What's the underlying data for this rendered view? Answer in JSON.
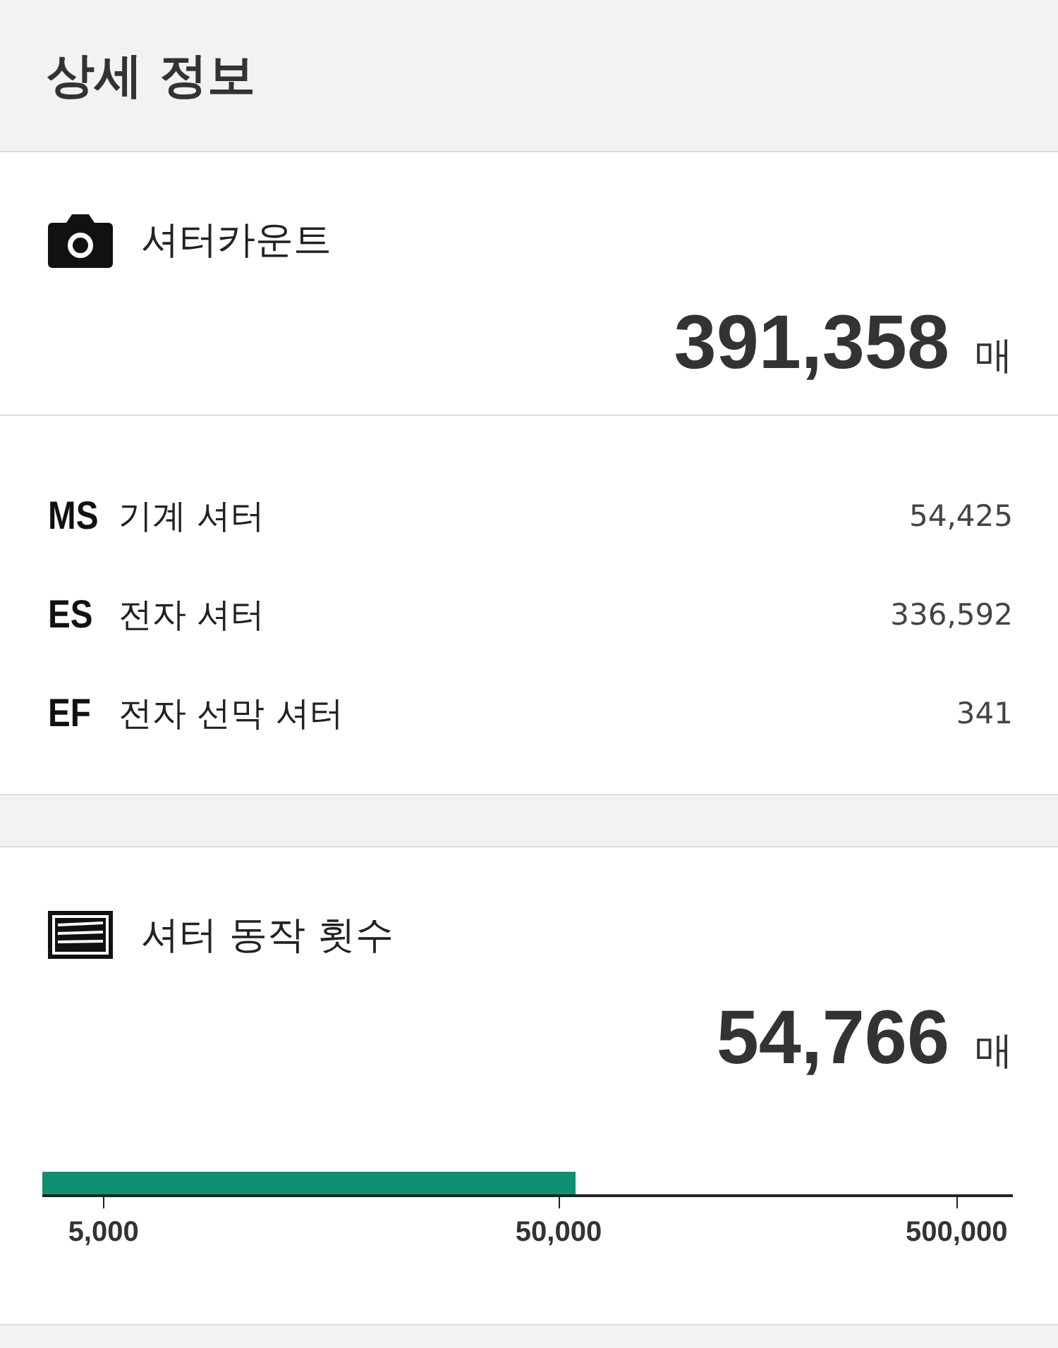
{
  "header": {
    "title": "상세 정보"
  },
  "shutter_count": {
    "label": "셔터카운트",
    "value": "391,358",
    "unit": "매"
  },
  "breakdown": [
    {
      "code": "MS",
      "label": "기계 셔터",
      "value": "54,425"
    },
    {
      "code": "ES",
      "label": "전자 셔터",
      "value": "336,592"
    },
    {
      "code": "EF",
      "label": "전자 선막 셔터",
      "value": "341"
    }
  ],
  "actuations": {
    "label": "셔터 동작 횟수",
    "value": "54,766",
    "unit": "매",
    "meter": {
      "level": 0.55,
      "ticks": [
        "5,000",
        "50,000",
        "500,000"
      ]
    }
  }
}
